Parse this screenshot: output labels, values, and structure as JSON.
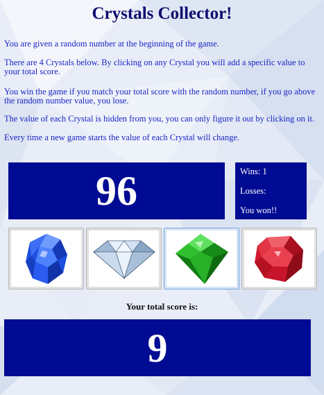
{
  "game": {
    "title": "Crystals Collector!",
    "instructions": [
      "You are given a random number at the beginning of the game.",
      "There are 4 Crystals below. By clicking on any Crystal you will add a specific value to your total score.",
      "You win the game if you match your total score with the random number, if you go above the random number value, you lose.",
      "The value of each Crystal is hidden from you, you can only figure it out by clicking on it.",
      "Every time a new game starts the value of each Crystal will change."
    ]
  },
  "target_number": "96",
  "stats": {
    "wins": "Wins: 1",
    "losses": "Losses:",
    "message": "You won!!"
  },
  "crystals": [
    {
      "icon": "blue-crystal-icon",
      "color": "#1d4fe0"
    },
    {
      "icon": "diamond-icon",
      "color": "#8fb2d6"
    },
    {
      "icon": "green-crystal-icon",
      "color": "#1fa61f"
    },
    {
      "icon": "red-crystal-icon",
      "color": "#d1192c"
    }
  ],
  "score": {
    "label": "Your total score is:",
    "value": "9"
  },
  "colors": {
    "panel": "#000b93",
    "title": "#0c0c6e",
    "instruction_text": "#1a24c6"
  }
}
